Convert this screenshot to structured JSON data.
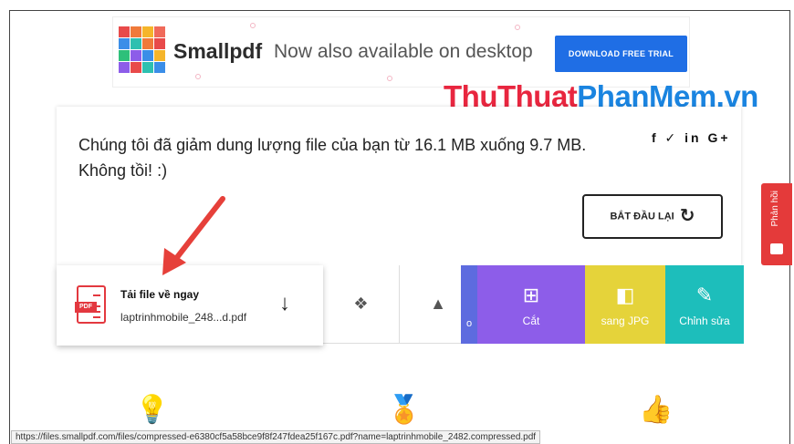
{
  "ad": {
    "brand": "Smallpdf",
    "slogan": "Now also available on desktop",
    "cta": "DOWNLOAD FREE TRIAL"
  },
  "watermark": {
    "part1": "ThuThuat",
    "part2": "PhanMem.vn"
  },
  "card": {
    "message_line1": "Chúng tôi đã giảm dung lượng file của bạn từ 16.1 MB xuống 9.7 MB.",
    "message_line2": "Không tồi! :)",
    "share": "f ✓ in G+",
    "restart": "BẮT ĐẦU LẠI"
  },
  "download": {
    "title": "Tải file về ngay",
    "filename": "laptrinhmobile_248...d.pdf",
    "pdf_tag": "PDF"
  },
  "tools": {
    "edge_label": "o",
    "cut": "Cắt",
    "jpg": "sang JPG",
    "edit": "Chỉnh sửa"
  },
  "feedback": {
    "label": "Phản hồi"
  },
  "status_url": "https://files.smallpdf.com/files/compressed-e6380cf5a58bce9f8f247fdea25f167c.pdf?name=laptrinhmobile_2482.compressed.pdf",
  "colors": {
    "accent_blue": "#1f6ee5",
    "tool_purple": "#8d5de9",
    "tool_yellow": "#e5d33a",
    "tool_teal": "#1dbebb",
    "feedback_red": "#e43a3a"
  }
}
